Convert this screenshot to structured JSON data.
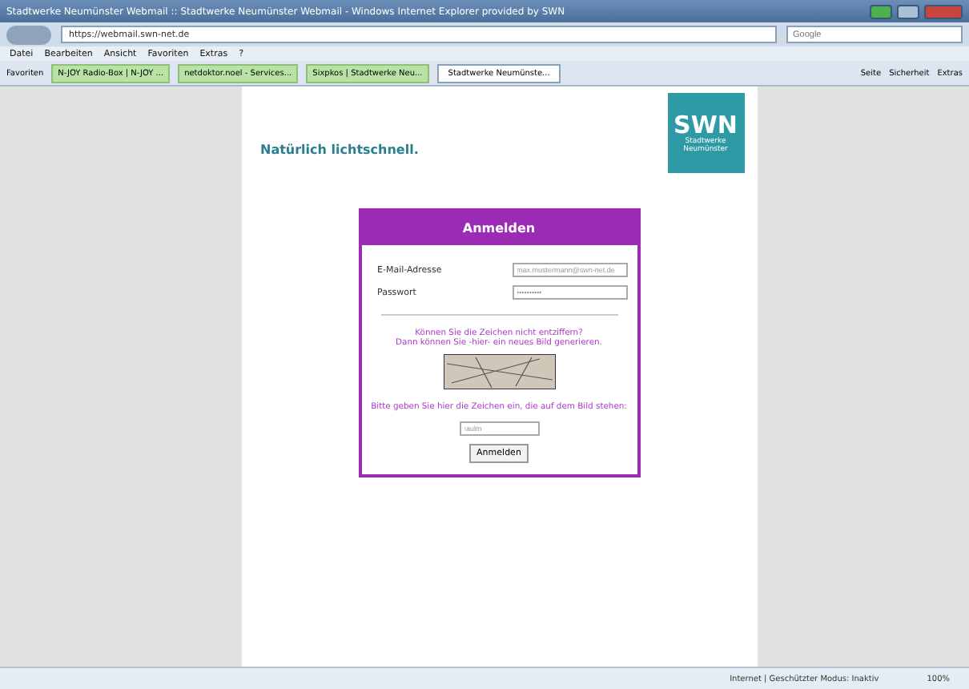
{
  "window": {
    "title": "Stadtwerke Neumünster Webmail :: Stadtwerke Neumünster Webmail - Windows Internet Explorer provided by SWN"
  },
  "address_bar": {
    "url": "https://webmail.swn-net.de",
    "search_placeholder": "Google"
  },
  "menu": [
    "Datei",
    "Bearbeiten",
    "Ansicht",
    "Favoriten",
    "Extras",
    "?"
  ],
  "favorites_bar": {
    "label": "Favoriten",
    "links": [
      "N-JOY Radio-Box | N-JOY ...",
      "netdoktor.noel - Services...",
      "Sixpkos | Stadtwerke Neu..."
    ]
  },
  "tabs": [
    {
      "label": "Stadtwerke Neumünste...",
      "selected": true
    }
  ],
  "command_bar": [
    "Seite",
    "Sicherheit",
    "Extras"
  ],
  "page": {
    "slogan": "Natürlich lichtschnell.",
    "logo": {
      "mark": "SWN",
      "subtitle": "Stadtwerke Neumünster"
    },
    "login": {
      "title": "Anmelden",
      "fields": [
        {
          "label": "E-Mail-Adresse",
          "value": "max.mustermann@swn-net.de"
        },
        {
          "label": "Passwort",
          "value": "••••••••••"
        }
      ],
      "captcha_hint": "Können Sie die Zeichen nicht entziffern?",
      "captcha_hint_2": "Dann können Sie -hier- ein neues Bild generieren.",
      "captcha_prompt": "Bitte geben Sie hier die Zeichen ein, die auf dem Bild stehen:",
      "captcha_input": {
        "value": "raulm"
      },
      "button": "Anmelden"
    }
  },
  "status_bar": {
    "zone": "Internet | Geschützter Modus: Inaktiv",
    "zoom": "100%"
  }
}
